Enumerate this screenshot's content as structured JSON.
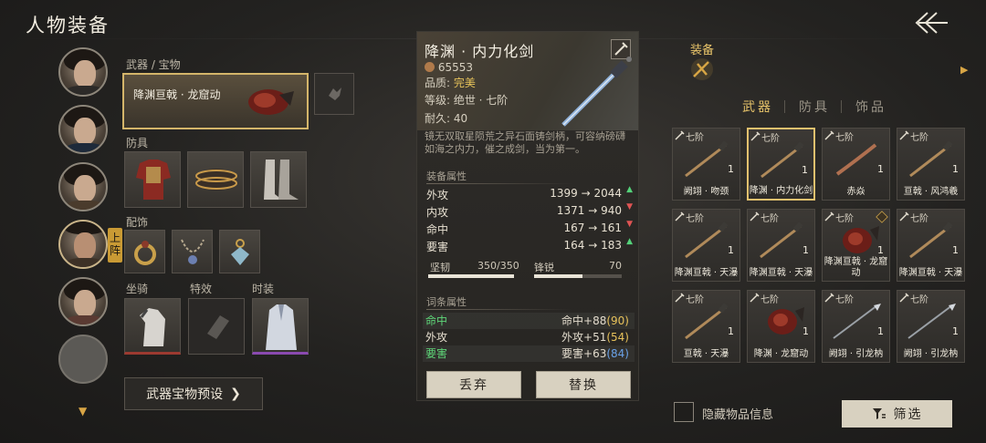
{
  "header": {
    "title": "人物装备"
  },
  "left": {
    "weapon_section_label": "武器 / 宝物",
    "weapon_slot_name": "降渊亘戟 · 龙窟动",
    "armor_section_label": "防具",
    "accessory_section_label": "配饰",
    "team_badge": "上阵",
    "mount_label": "坐骑",
    "effect_label": "特效",
    "fashion_label": "时装",
    "preset_button": "武器宝物预设"
  },
  "detail": {
    "name": "降渊 · 内力化剑",
    "price": "65553",
    "quality_label": "品质:",
    "quality_value": "完美",
    "grade": "等级: 绝世 · 七阶",
    "durability": "耐久: 40",
    "description": "镜无双取星陨荒之异石面铸剑柄，可容纳磅礴如海之内力，催之成剑，当为第一。",
    "attr_title": "装备属性",
    "stats": [
      {
        "key": "外攻",
        "value": "1399 → 2044",
        "dir": "up"
      },
      {
        "key": "内攻",
        "value": "1371 → 940",
        "dir": "down"
      },
      {
        "key": "命中",
        "value": "167 → 161",
        "dir": "down"
      },
      {
        "key": "要害",
        "value": "164 → 183",
        "dir": "up"
      }
    ],
    "toughness_label": "坚韧",
    "toughness_value": "350/350",
    "toughness_ratio": 1.0,
    "sharpness_label": "锋锐",
    "sharpness_value": "70",
    "sharpness_ratio": 0.55,
    "affix_title": "词条属性",
    "affixes": [
      {
        "key": "命中",
        "base": "命中+88",
        "extra": "(90)",
        "green": true,
        "extra_color": "yellow"
      },
      {
        "key": "外攻",
        "base": "外攻+51",
        "extra": "(54)",
        "green": false,
        "extra_color": "yellow"
      },
      {
        "key": "要害",
        "base": "要害+63",
        "extra": "(84)",
        "green": true,
        "extra_color": "blue"
      }
    ],
    "discard_button": "丢弃",
    "replace_button": "替换"
  },
  "right": {
    "equip_label": "装备",
    "tabs": [
      "武器",
      "防具",
      "饰品"
    ],
    "active_tab": 0,
    "items": [
      {
        "tier": "七阶",
        "qty": "1",
        "name": "阙翊 · 吻颈",
        "type": "sword"
      },
      {
        "tier": "七阶",
        "qty": "1",
        "name": "降渊 · 内力化剑",
        "type": "sword",
        "selected": true
      },
      {
        "tier": "七阶",
        "qty": "1",
        "name": "赤焱",
        "type": "blade"
      },
      {
        "tier": "七阶",
        "qty": "1",
        "name": "亘戟 · 风鸿羲",
        "type": "sword"
      },
      {
        "tier": "七阶",
        "qty": "1",
        "name": "降渊亘戟 · 天瀑",
        "type": "sword"
      },
      {
        "tier": "七阶",
        "qty": "1",
        "name": "降渊亘戟 · 天瀑",
        "type": "sword"
      },
      {
        "tier": "七阶",
        "qty": "1",
        "name": "降渊亘戟 · 龙窟动",
        "type": "gauntlet",
        "badge": true
      },
      {
        "tier": "七阶",
        "qty": "1",
        "name": "降渊亘戟 · 天瀑",
        "type": "sword"
      },
      {
        "tier": "七阶",
        "qty": "1",
        "name": "亘戟 · 天瀑",
        "type": "sword"
      },
      {
        "tier": "七阶",
        "qty": "1",
        "name": "降渊 · 龙窟动",
        "type": "gauntlet"
      },
      {
        "tier": "七阶",
        "qty": "1",
        "name": "阙翊 · 引龙枘",
        "type": "spear"
      },
      {
        "tier": "七阶",
        "qty": "1",
        "name": "阙翊 · 引龙枘",
        "type": "spear"
      }
    ],
    "hide_info_label": "隐藏物品信息",
    "filter_button": "筛选"
  }
}
